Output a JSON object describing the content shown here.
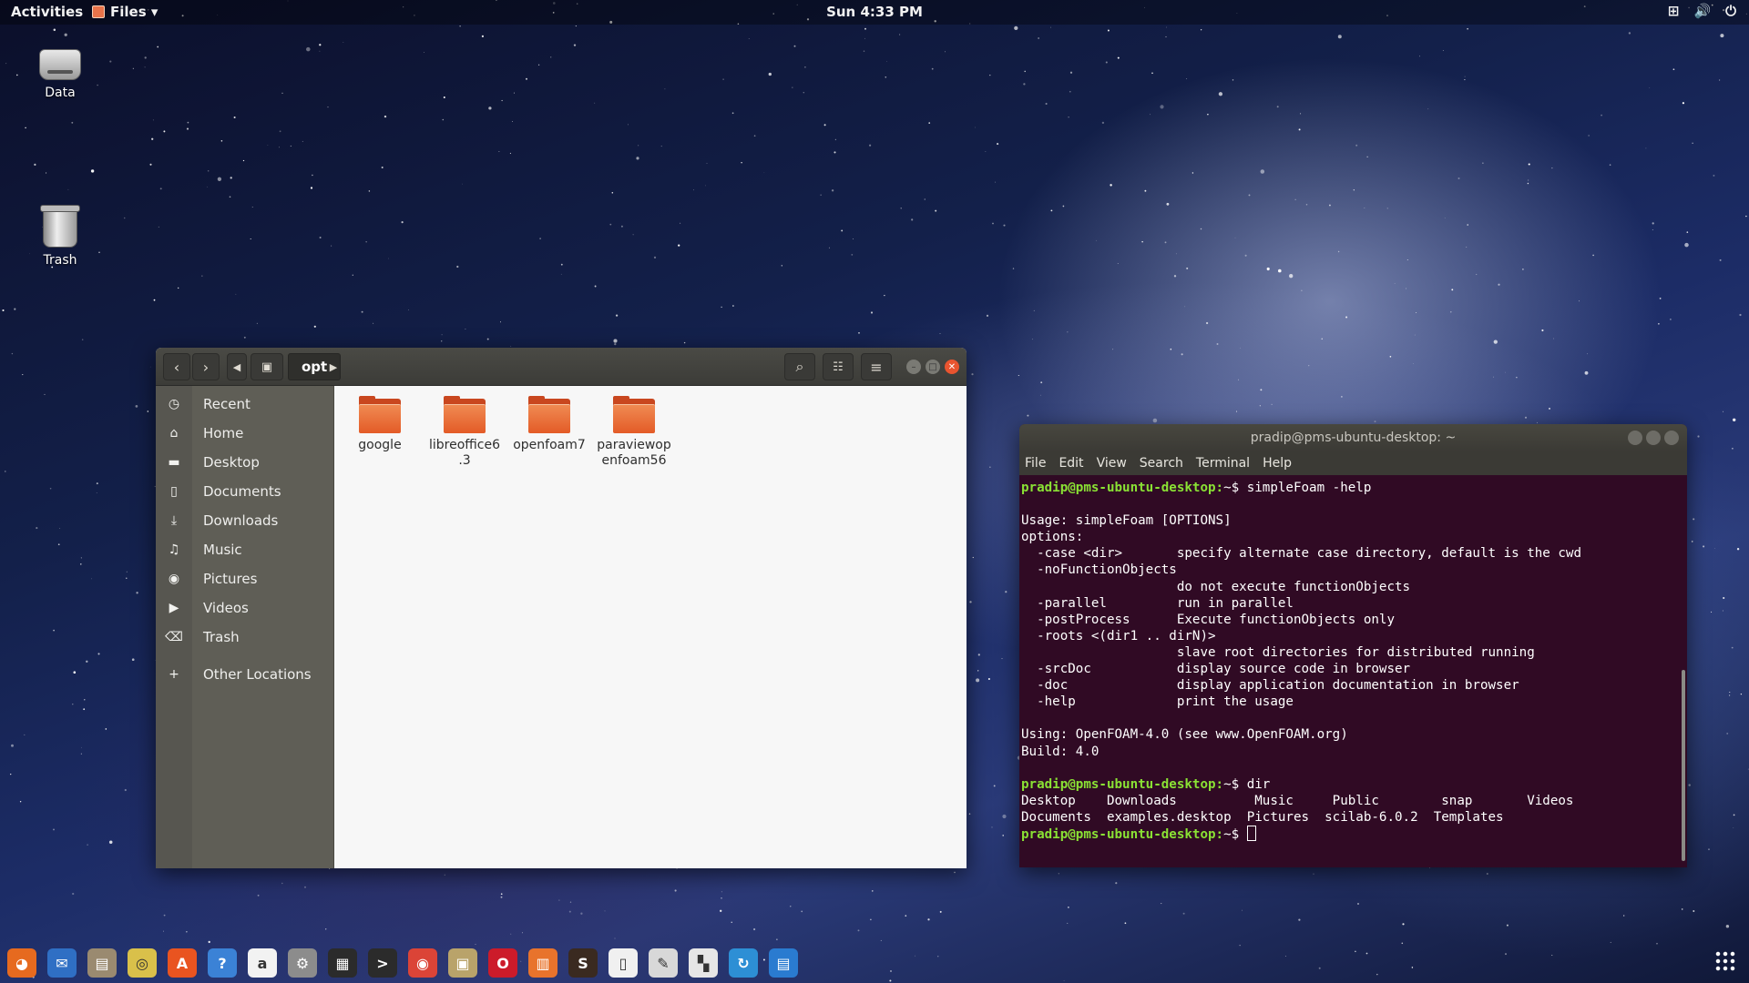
{
  "topbar": {
    "activities": "Activities",
    "app_menu": "Files ▾",
    "clock": "Sun  4:33 PM",
    "tray": {
      "network": "⊞",
      "volume": "🔊",
      "power": "⏻"
    }
  },
  "desktop": {
    "icons": [
      {
        "label": "Data"
      },
      {
        "label": "Trash"
      }
    ]
  },
  "files": {
    "path": "opt",
    "sidebar": [
      {
        "label": "Recent",
        "icon": "recent-icon",
        "glyph": "◷"
      },
      {
        "label": "Home",
        "icon": "home-icon",
        "glyph": "⌂"
      },
      {
        "label": "Desktop",
        "icon": "desktop-folder-icon",
        "glyph": "▬"
      },
      {
        "label": "Documents",
        "icon": "documents-icon",
        "glyph": "▯"
      },
      {
        "label": "Downloads",
        "icon": "downloads-icon",
        "glyph": "⤓"
      },
      {
        "label": "Music",
        "icon": "music-icon",
        "glyph": "♫"
      },
      {
        "label": "Pictures",
        "icon": "pictures-icon",
        "glyph": "◉"
      },
      {
        "label": "Videos",
        "icon": "videos-icon",
        "glyph": "▶"
      },
      {
        "label": "Trash",
        "icon": "trash-icon",
        "glyph": "⌫"
      },
      {
        "label": "Other Locations",
        "icon": "plus-icon",
        "glyph": "+"
      }
    ],
    "folders": [
      {
        "line1": "google",
        "line2": ""
      },
      {
        "line1": "libreoffice6",
        "line2": ".3"
      },
      {
        "line1": "openfoam7",
        "line2": ""
      },
      {
        "line1": "paraviewop",
        "line2": "enfoam56"
      }
    ]
  },
  "terminal": {
    "title": "pradip@pms-ubuntu-desktop: ~",
    "menu": [
      "File",
      "Edit",
      "View",
      "Search",
      "Terminal",
      "Help"
    ],
    "prompt": "pradip@pms-ubuntu-desktop:",
    "lines": [
      {
        "prompt": true,
        "text": "~$ simpleFoam -help"
      },
      {
        "text": ""
      },
      {
        "text": "Usage: simpleFoam [OPTIONS]"
      },
      {
        "text": "options:"
      },
      {
        "text": "  -case <dir>       specify alternate case directory, default is the cwd"
      },
      {
        "text": "  -noFunctionObjects"
      },
      {
        "text": "                    do not execute functionObjects"
      },
      {
        "text": "  -parallel         run in parallel"
      },
      {
        "text": "  -postProcess      Execute functionObjects only"
      },
      {
        "text": "  -roots <(dir1 .. dirN)>"
      },
      {
        "text": "                    slave root directories for distributed running"
      },
      {
        "text": "  -srcDoc           display source code in browser"
      },
      {
        "text": "  -doc              display application documentation in browser"
      },
      {
        "text": "  -help             print the usage"
      },
      {
        "text": ""
      },
      {
        "text": "Using: OpenFOAM-4.0 (see www.OpenFOAM.org)"
      },
      {
        "text": "Build: 4.0"
      },
      {
        "text": ""
      },
      {
        "prompt": true,
        "text": "~$ dir"
      },
      {
        "text": "Desktop    Downloads          Music     Public        snap       Videos"
      },
      {
        "text": "Documents  examples.desktop  Pictures  scilab-6.0.2  Templates"
      },
      {
        "prompt": true,
        "text": "~$ ",
        "cursor": true
      }
    ]
  },
  "dock": [
    {
      "name": "firefox-icon",
      "color": "#e66a1f",
      "glyph": "◕"
    },
    {
      "name": "thunderbird-icon",
      "color": "#2f6fc4",
      "glyph": "✉"
    },
    {
      "name": "files-icon",
      "color": "#9a8a70",
      "glyph": "▤"
    },
    {
      "name": "rhythmbox-icon",
      "color": "#d9c04a",
      "glyph": "◎"
    },
    {
      "name": "software-center-icon",
      "color": "#e95420",
      "glyph": "A"
    },
    {
      "name": "help-icon",
      "color": "#3b82d6",
      "glyph": "?"
    },
    {
      "name": "amazon-icon",
      "color": "#f2f2f2",
      "glyph": "a"
    },
    {
      "name": "settings-icon",
      "color": "#8c8c8c",
      "glyph": "⚙"
    },
    {
      "name": "system-monitor-icon",
      "color": "#2b2b2b",
      "glyph": "▦"
    },
    {
      "name": "terminal-icon",
      "color": "#2b2b2b",
      "glyph": ">"
    },
    {
      "name": "chrome-icon",
      "color": "#db4437",
      "glyph": "◉"
    },
    {
      "name": "archive-manager-icon",
      "color": "#b9a36a",
      "glyph": "▣"
    },
    {
      "name": "opera-icon",
      "color": "#cc1b2a",
      "glyph": "O"
    },
    {
      "name": "libreoffice-impress-icon",
      "color": "#e8732c",
      "glyph": "▥"
    },
    {
      "name": "sublime-icon",
      "color": "#3a2a20",
      "glyph": "S"
    },
    {
      "name": "text-document-icon",
      "color": "#f0f0f0",
      "glyph": "▯"
    },
    {
      "name": "text-editor-icon",
      "color": "#d8d8d8",
      "glyph": "✎"
    },
    {
      "name": "scilab-icon",
      "color": "#e6e6e6",
      "glyph": "▚"
    },
    {
      "name": "updates-icon",
      "color": "#2d8fd5",
      "glyph": "↻"
    },
    {
      "name": "libreoffice-writer-icon",
      "color": "#2a7bd0",
      "glyph": "▤"
    }
  ]
}
